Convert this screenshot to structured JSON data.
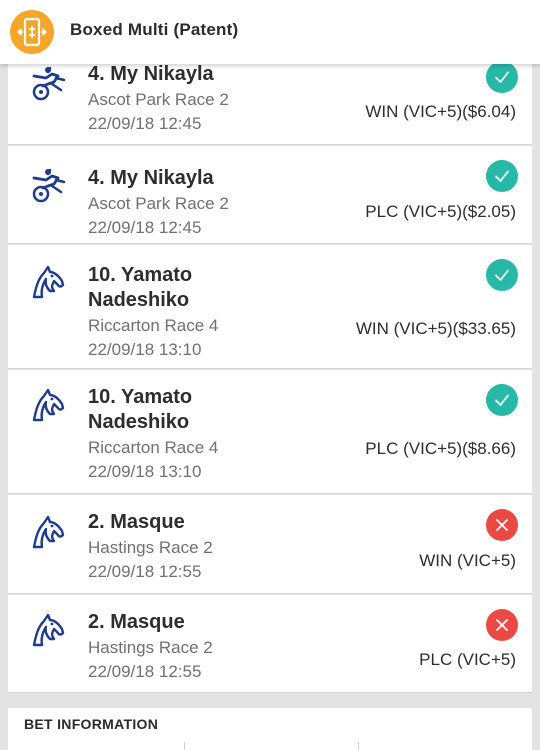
{
  "header": {
    "title": "Boxed Multi (Patent)",
    "icon": "boxed-multi-icon",
    "accent": "#f5a52a"
  },
  "legs": [
    {
      "name": "4. My Nikayla",
      "race": "Ascot Park Race 2",
      "datetime": "22/09/18 12:45",
      "bet": "WIN (VIC+5)($6.04)",
      "status": "won",
      "icon": "harness-racing-icon"
    },
    {
      "name": "4. My Nikayla",
      "race": "Ascot Park Race 2",
      "datetime": "22/09/18 12:45",
      "bet": "PLC (VIC+5)($2.05)",
      "status": "won",
      "icon": "harness-racing-icon"
    },
    {
      "name": "10. Yamato Nadeshiko",
      "race": "Riccarton Race 4",
      "datetime": "22/09/18 13:10",
      "bet": "WIN (VIC+5)($33.65)",
      "status": "won",
      "icon": "horse-racing-icon"
    },
    {
      "name": "10. Yamato Nadeshiko",
      "race": "Riccarton Race 4",
      "datetime": "22/09/18 13:10",
      "bet": "PLC (VIC+5)($8.66)",
      "status": "won",
      "icon": "horse-racing-icon"
    },
    {
      "name": "2. Masque",
      "race": "Hastings Race 2",
      "datetime": "22/09/18 12:55",
      "bet": "WIN (VIC+5)",
      "status": "lost",
      "icon": "horse-racing-icon"
    },
    {
      "name": "2. Masque",
      "race": "Hastings Race 2",
      "datetime": "22/09/18 12:55",
      "bet": "PLC (VIC+5)",
      "status": "lost",
      "icon": "horse-racing-icon"
    }
  ],
  "bet_information": {
    "title": "BET INFORMATION"
  },
  "colors": {
    "won": "#26b9a8",
    "lost": "#ea4a43",
    "icon_blue": "#1f3b8c"
  }
}
